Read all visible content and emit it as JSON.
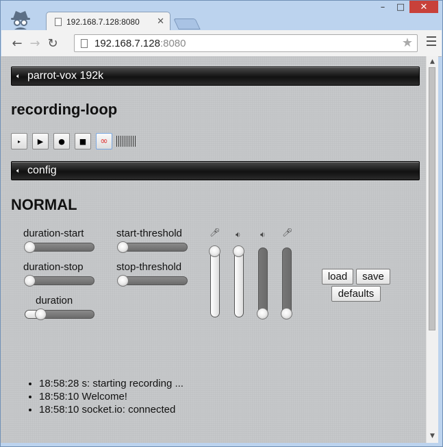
{
  "browser": {
    "tab_title": "192.168.7.128:8080",
    "url_host": "192.168.7.128",
    "url_port": ":8080",
    "window_controls": [
      "–",
      "□",
      "✕"
    ]
  },
  "app": {
    "stream_bar": {
      "label": "parrot-vox 192k",
      "icon": "speaker-icon"
    },
    "title": "recording-loop",
    "transport": {
      "buttons": [
        {
          "name": "step",
          "glyph": "▸"
        },
        {
          "name": "play",
          "glyph": "▶"
        },
        {
          "name": "record",
          "glyph": "●"
        },
        {
          "name": "stop",
          "glyph": "■"
        },
        {
          "name": "loop",
          "glyph": "∞"
        }
      ],
      "level_meter_ticks": 10
    },
    "config_bar": {
      "label": "config",
      "icon": "speaker-icon"
    },
    "mode": "NORMAL",
    "sliders": {
      "duration_start": {
        "label": "duration-start",
        "value": 0.0
      },
      "duration_stop": {
        "label": "duration-stop",
        "value": 0.0
      },
      "duration": {
        "label": "duration",
        "value": 0.18
      },
      "start_threshold": {
        "label": "start-threshold",
        "value": 0.0
      },
      "stop_threshold": {
        "label": "stop-threshold",
        "value": 0.0
      }
    },
    "vertical_sliders": [
      {
        "icon": "microphone-icon",
        "value": 1.0
      },
      {
        "icon": "volume-icon",
        "value": 1.0
      },
      {
        "icon": "volume-icon",
        "value": 0.0
      },
      {
        "icon": "microphone-icon",
        "value": 0.0
      }
    ],
    "buttons": {
      "load": "load",
      "save": "save",
      "defaults": "defaults"
    },
    "log": [
      "18:58:28 s: starting recording ...",
      "18:58:10 Welcome!",
      "18:58:10 socket.io: connected"
    ]
  }
}
